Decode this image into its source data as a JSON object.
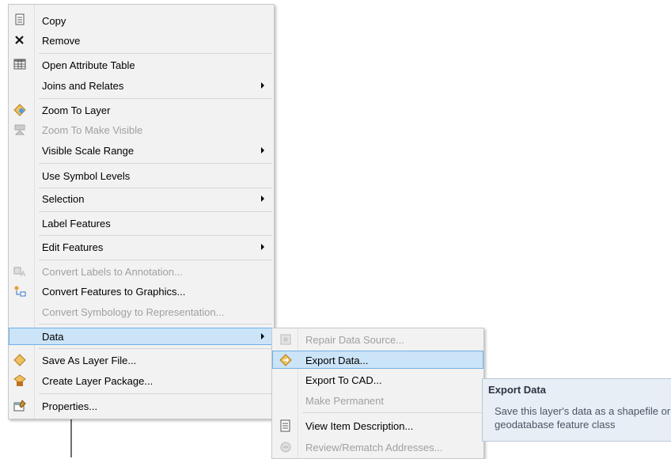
{
  "context_menu": {
    "items": [
      {
        "label": "Copy",
        "icon": "copy-icon",
        "disabled": false
      },
      {
        "label": "Remove",
        "icon": "remove-x-icon",
        "disabled": false
      },
      {
        "label": "Open Attribute Table",
        "icon": "table-icon",
        "disabled": false
      },
      {
        "label": "Joins and Relates",
        "icon": "",
        "disabled": false,
        "submenu": true
      },
      {
        "label": "Zoom To Layer",
        "icon": "zoom-layer-icon",
        "disabled": false
      },
      {
        "label": "Zoom To Make Visible",
        "icon": "zoom-visible-icon",
        "disabled": true
      },
      {
        "label": "Visible Scale Range",
        "icon": "",
        "disabled": false,
        "submenu": true
      },
      {
        "label": "Use Symbol Levels",
        "icon": "",
        "disabled": false
      },
      {
        "label": "Selection",
        "icon": "",
        "disabled": false,
        "submenu": true
      },
      {
        "label": "Label Features",
        "icon": "",
        "disabled": false
      },
      {
        "label": "Edit Features",
        "icon": "",
        "disabled": false,
        "submenu": true
      },
      {
        "label": "Convert Labels to Annotation...",
        "icon": "convert-labels-icon",
        "disabled": true
      },
      {
        "label": "Convert Features to Graphics...",
        "icon": "convert-features-icon",
        "disabled": false
      },
      {
        "label": "Convert Symbology to Representation...",
        "icon": "",
        "disabled": true
      },
      {
        "label": "Data",
        "icon": "",
        "disabled": false,
        "submenu": true,
        "highlighted": true
      },
      {
        "label": "Save As Layer File...",
        "icon": "layer-file-icon",
        "disabled": false
      },
      {
        "label": "Create Layer Package...",
        "icon": "layer-package-icon",
        "disabled": false
      },
      {
        "label": "Properties...",
        "icon": "properties-icon",
        "disabled": false
      }
    ]
  },
  "data_submenu": {
    "items": [
      {
        "label": "Repair Data Source...",
        "icon": "repair-icon",
        "disabled": true
      },
      {
        "label": "Export Data...",
        "icon": "export-data-icon",
        "disabled": false,
        "highlighted": true
      },
      {
        "label": "Export To CAD...",
        "icon": "",
        "disabled": false
      },
      {
        "label": "Make Permanent",
        "icon": "",
        "disabled": true
      },
      {
        "label": "View Item Description...",
        "icon": "item-description-icon",
        "disabled": false
      },
      {
        "label": "Review/Rematch Addresses...",
        "icon": "rematch-icon",
        "disabled": true
      }
    ]
  },
  "tooltip": {
    "title": "Export Data",
    "body": "Save this layer's data as a shapefile or geodatabase feature class"
  },
  "colors": {
    "menu_bg": "#f2f2f2",
    "highlight_bg": "#cce4f7",
    "highlight_border": "#6fb0e8",
    "disabled_text": "#a0a0a0",
    "tooltip_bg": "#e8eef6"
  }
}
